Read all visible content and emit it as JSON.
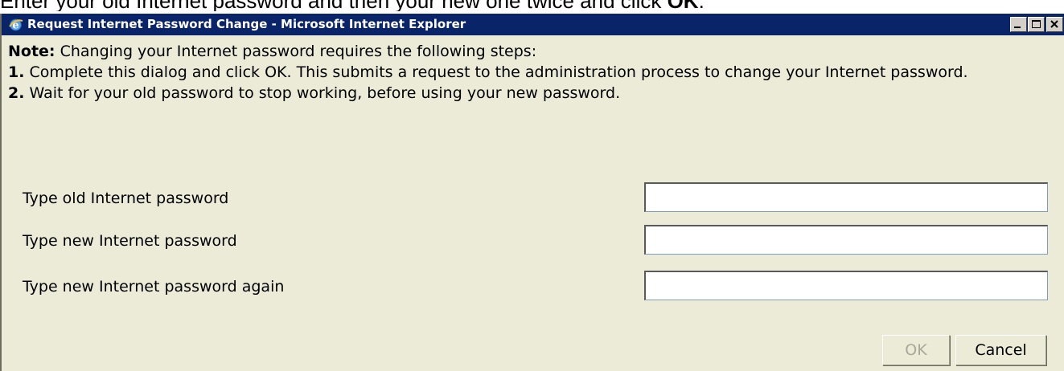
{
  "instruction": {
    "prefix": "Enter your old Internet password and then your new one twice and click ",
    "ok_word": "OK",
    "suffix": "."
  },
  "window": {
    "title": "Request Internet Password Change - Microsoft Internet Explorer",
    "icon": "ie-icon",
    "controls": [
      "minimize-icon",
      "maximize-icon",
      "close-icon"
    ]
  },
  "note": {
    "label": "Note:",
    "text": " Changing your Internet password requires the following steps:",
    "steps": [
      {
        "num": "1.",
        "text": " Complete this dialog and click OK. This submits a request to the administration process to change your Internet password."
      },
      {
        "num": "2.",
        "text": " Wait for your old password to stop working, before using your new password."
      }
    ]
  },
  "form": {
    "fields": [
      {
        "label": "Type old Internet password",
        "value": ""
      },
      {
        "label": "Type new Internet password",
        "value": ""
      },
      {
        "label": "Type new Internet password again",
        "value": ""
      }
    ],
    "ok_label": "OK",
    "cancel_label": "Cancel"
  }
}
